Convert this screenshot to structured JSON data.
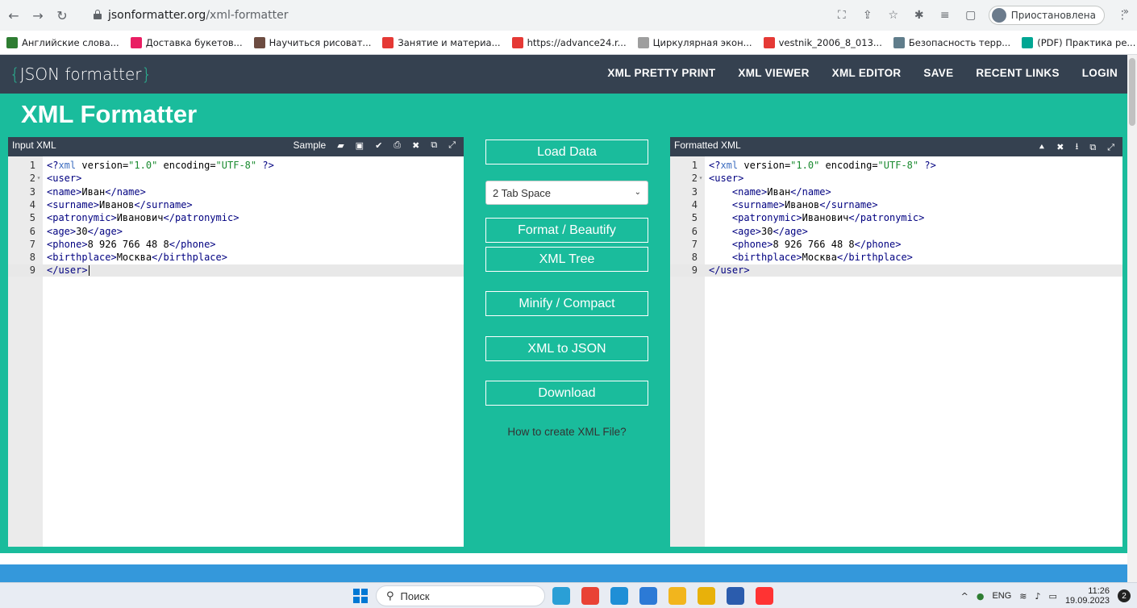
{
  "browser": {
    "url_host": "jsonformatter.org",
    "url_path": "/xml-formatter",
    "profile_label": "Приостановлена",
    "bookmarks": [
      {
        "label": "Английские слова...",
        "color": "#2e7d32"
      },
      {
        "label": "Доставка букетов...",
        "color": "#e91e63"
      },
      {
        "label": "Научиться рисоват...",
        "color": "#6d4c41"
      },
      {
        "label": "Занятие и материа...",
        "color": "#e53935"
      },
      {
        "label": "https://advance24.r...",
        "color": "#e53935"
      },
      {
        "label": "Циркулярная экон...",
        "color": "#9e9e9e"
      },
      {
        "label": "vestnik_2006_8_013...",
        "color": "#e53935"
      },
      {
        "label": "Безопасность терр...",
        "color": "#607d8b"
      },
      {
        "label": "(PDF) Практика ре...",
        "color": "#00a693"
      }
    ],
    "bookmarks_more": "»"
  },
  "site": {
    "logo_brace_open": "{",
    "logo_text": "JSON formatter",
    "logo_brace_close": "}",
    "nav": [
      "XML PRETTY PRINT",
      "XML VIEWER",
      "XML EDITOR",
      "SAVE",
      "RECENT LINKS",
      "LOGIN"
    ]
  },
  "page": {
    "title": "XML Formatter"
  },
  "input_panel": {
    "title": "Input XML",
    "sample_label": "Sample",
    "lines": [
      "<?xml version=\"1.0\" encoding=\"UTF-8\" ?>",
      "<user>",
      "<name>Иван</name>",
      "<surname>Иванов</surname>",
      "<patronymic>Иванович</patronymic>",
      "<age>30</age>",
      "<phone>8 926 766 48 8</phone>",
      "<birthplace>Москва</birthplace>",
      "</user>"
    ]
  },
  "output_panel": {
    "title": "Formatted XML",
    "lines": [
      "<?xml version=\"1.0\" encoding=\"UTF-8\" ?>",
      "<user>",
      "    <name>Иван</name>",
      "    <surname>Иванов</surname>",
      "    <patronymic>Иванович</patronymic>",
      "    <age>30</age>",
      "    <phone>8 926 766 48 8</phone>",
      "    <birthplace>Москва</birthplace>",
      "</user>"
    ]
  },
  "controls": {
    "load_data": "Load Data",
    "tab_select": "2 Tab Space",
    "format": "Format / Beautify",
    "xml_tree": "XML Tree",
    "minify": "Minify / Compact",
    "to_json": "XML to JSON",
    "download": "Download",
    "help_link": "How to create XML File?"
  },
  "taskbar": {
    "search_label": "Поиск",
    "lang": "ENG",
    "time": "11:26",
    "date": "19.09.2023",
    "notifications": "2",
    "apps": [
      {
        "name": "telegram",
        "color": "#2a9fd6"
      },
      {
        "name": "chrome",
        "color": "#e94235"
      },
      {
        "name": "edge",
        "color": "#1f8fd6"
      },
      {
        "name": "vscode",
        "color": "#2c7ad6"
      },
      {
        "name": "explorer",
        "color": "#f2b51d"
      },
      {
        "name": "powerbi",
        "color": "#e8b10a"
      },
      {
        "name": "word",
        "color": "#2b5cad"
      },
      {
        "name": "yandex",
        "color": "#ff3333"
      }
    ]
  },
  "colors": {
    "teal": "#1abc9c",
    "header": "#354150",
    "footer": "#3498db"
  }
}
